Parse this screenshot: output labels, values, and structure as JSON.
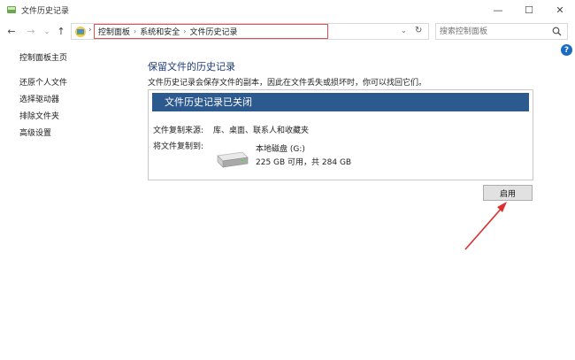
{
  "window": {
    "title": "文件历史记录",
    "minimize_glyph": "—",
    "maximize_glyph": "☐",
    "close_glyph": "✕"
  },
  "nav": {
    "back_glyph": "←",
    "forward_glyph": "→",
    "dropdown_glyph": "⌄",
    "up_glyph": "↑",
    "breadcrumb": [
      "控制面板",
      "系统和安全",
      "文件历史记录"
    ],
    "breadcrumb_separator": "›",
    "address_dropdown_glyph": "⌄",
    "refresh_glyph": "↻"
  },
  "search": {
    "placeholder": "搜索控制面板"
  },
  "help": {
    "glyph": "?"
  },
  "sidebar": {
    "home_label": "控制面板主页",
    "items": [
      {
        "label": "还原个人文件"
      },
      {
        "label": "选择驱动器"
      },
      {
        "label": "排除文件夹"
      },
      {
        "label": "高级设置"
      }
    ]
  },
  "main": {
    "title": "保留文件的历史记录",
    "description": "文件历史记录会保存文件的副本，因此在文件丢失或损坏时，你可以找回它们。",
    "status_header": "文件历史记录已关闭",
    "source_label": "文件复制来源:",
    "source_value": "库、桌面、联系人和收藏夹",
    "dest_label": "将文件复制到:",
    "drive_name": "本地磁盘 (G:)",
    "drive_space": "225 GB 可用，共 284 GB",
    "enable_button": "启用"
  },
  "colors": {
    "accent": "#2d5a8e",
    "highlight_box": "#e05050",
    "annotation_arrow": "#d93030"
  },
  "icons": [
    "control-panel-icon",
    "search-icon",
    "help-icon",
    "drive-icon"
  ]
}
